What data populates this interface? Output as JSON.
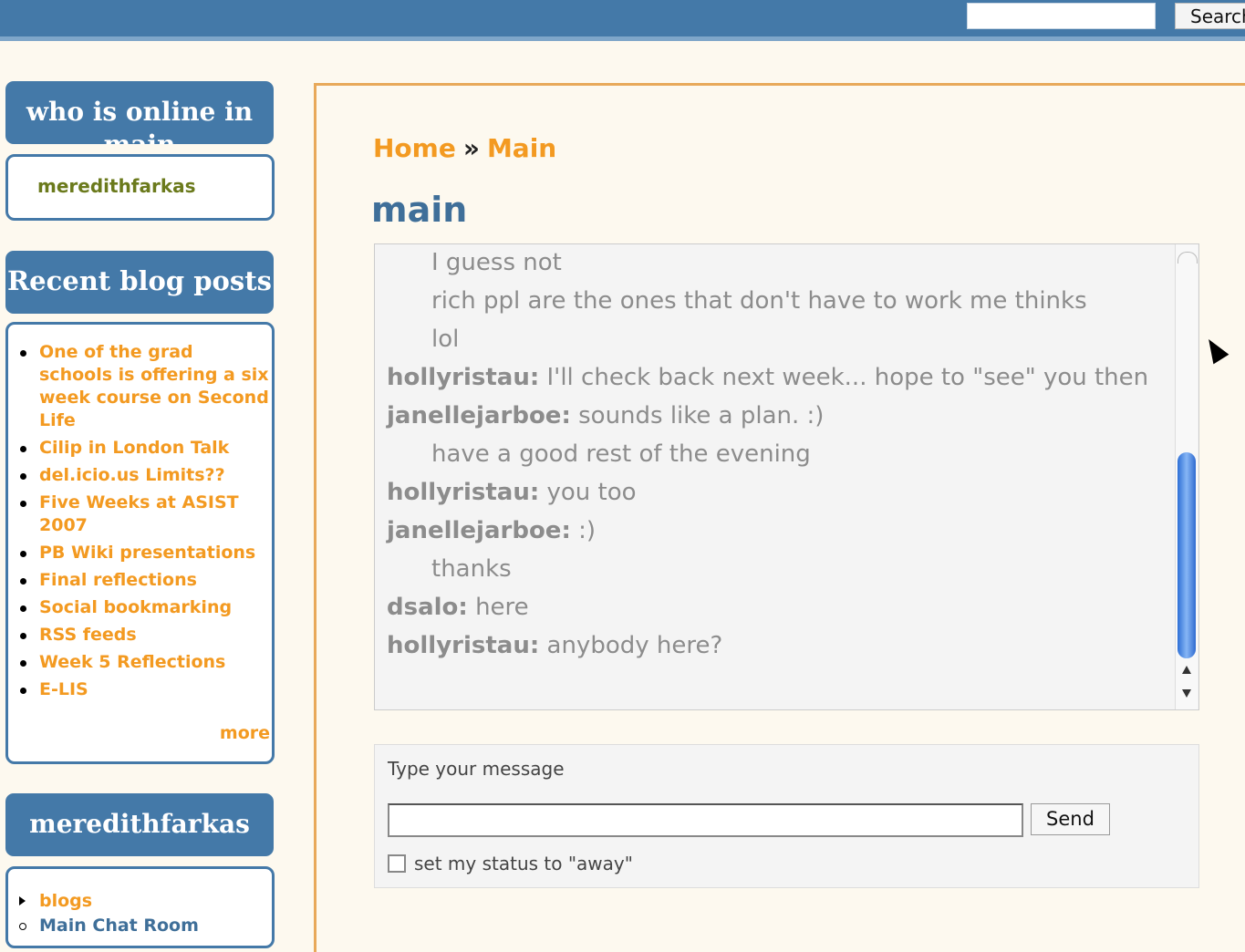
{
  "header": {
    "search_button": "Search"
  },
  "sidebar": {
    "online": {
      "title": "who is online in main",
      "user": "meredithfarkas"
    },
    "recent": {
      "title": "Recent blog posts",
      "posts": [
        "One of the grad schools is offering a six week course on Second Life",
        "Cilip in London Talk",
        "del.icio.us Limits??",
        "Five Weeks at ASIST 2007",
        "PB Wiki presentations",
        "Final reflections",
        "Social bookmarking",
        "RSS feeds",
        "Week 5 Reflections",
        "E-LIS"
      ],
      "more": "more"
    },
    "user_block": {
      "title": "meredithfarkas",
      "links": [
        "blogs",
        "Main Chat Room"
      ]
    }
  },
  "content": {
    "breadcrumb": {
      "home": "Home",
      "separator": "»",
      "current": "Main"
    },
    "title": "main",
    "messages": [
      {
        "user": "",
        "text": "I guess not"
      },
      {
        "user": "",
        "text": "rich ppl are the ones that don't have to work me thinks"
      },
      {
        "user": "",
        "text": "lol"
      },
      {
        "user": "hollyristau:",
        "text": "I'll check back next week... hope to \"see\" you then"
      },
      {
        "user": "janellejarboe:",
        "text": "sounds like a plan. :)"
      },
      {
        "user": "",
        "text": "have a good rest of the evening"
      },
      {
        "user": "hollyristau:",
        "text": "you too"
      },
      {
        "user": "janellejarboe:",
        "text": ":)"
      },
      {
        "user": "",
        "text": "thanks"
      },
      {
        "user": "dsalo:",
        "text": "here"
      },
      {
        "user": "hollyristau:",
        "text": "anybody here?"
      }
    ],
    "composer": {
      "label": "Type your message",
      "send": "Send",
      "away": "set my status to \"away\""
    }
  }
}
